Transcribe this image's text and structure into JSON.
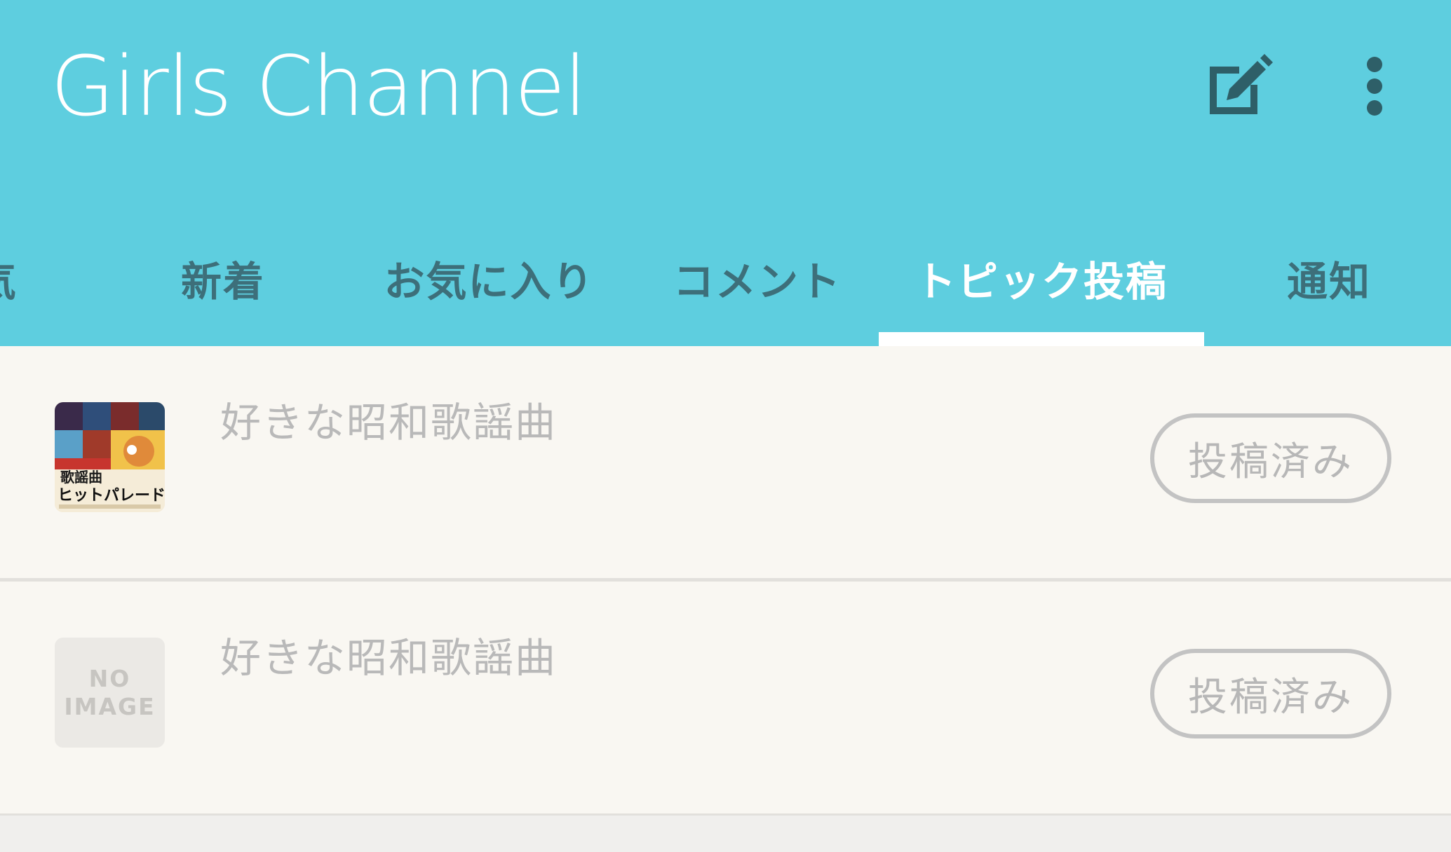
{
  "app": {
    "title": "Girls Channel"
  },
  "header_actions": {
    "edit_icon": "edit-square-icon",
    "more_icon": "more-vertical-icon"
  },
  "tabs": [
    {
      "label": "気",
      "active": false
    },
    {
      "label": "新着",
      "active": false
    },
    {
      "label": "お気に入り",
      "active": false
    },
    {
      "label": "コメント",
      "active": false
    },
    {
      "label": "トピック投稿",
      "active": true
    },
    {
      "label": "通知",
      "active": false
    }
  ],
  "topics": [
    {
      "title": "好きな昭和歌謡曲",
      "thumbnail": {
        "type": "image",
        "caption_line1": "歌謡曲",
        "caption_line2": "ヒットパレード"
      },
      "status_label": "投稿済み"
    },
    {
      "title": "好きな昭和歌謡曲",
      "thumbnail": {
        "type": "placeholder",
        "line1": "NO",
        "line2": "IMAGE"
      },
      "status_label": "投稿済み"
    }
  ],
  "colors": {
    "header_bg": "#5ecedf",
    "tab_inactive": "#3d6f7a",
    "tab_active": "#ffffff",
    "list_bg": "#f9f7f2",
    "muted_text": "#b9b9b9"
  }
}
